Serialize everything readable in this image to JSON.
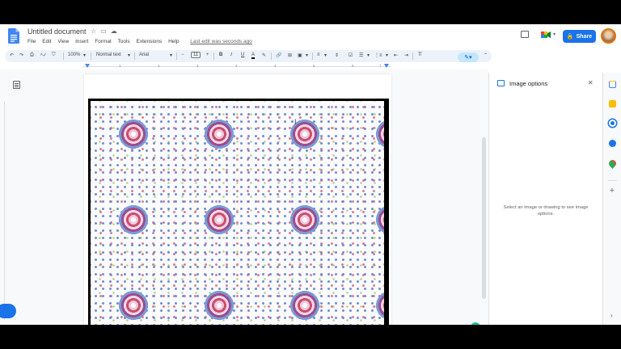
{
  "document": {
    "title": "Untitled document",
    "title_icons": [
      "star-icon",
      "move-folder-icon",
      "cloud-saved-icon"
    ]
  },
  "menu": {
    "items": [
      "File",
      "Edit",
      "View",
      "Insert",
      "Format",
      "Tools",
      "Extensions",
      "Help"
    ],
    "last_edit": "Last edit was seconds ago"
  },
  "header": {
    "share_label": "Share"
  },
  "toolbar": {
    "zoom": "100%",
    "style": "Normal text",
    "font": "Arial",
    "font_size": "11",
    "bold": "B",
    "italic": "I",
    "underline": "U",
    "text_color": "A",
    "decrease": "−",
    "increase": "+"
  },
  "ruler": {
    "numbers": [
      "1",
      "1",
      "2",
      "3",
      "4",
      "5",
      "6",
      "7"
    ]
  },
  "side_panel": {
    "title": "Image options",
    "message": "Select an image or drawing to see image options."
  },
  "colors": {
    "accent": "#1a73e8",
    "toolbar_bg": "#edf2fa",
    "grammarly": "#15c39a"
  }
}
